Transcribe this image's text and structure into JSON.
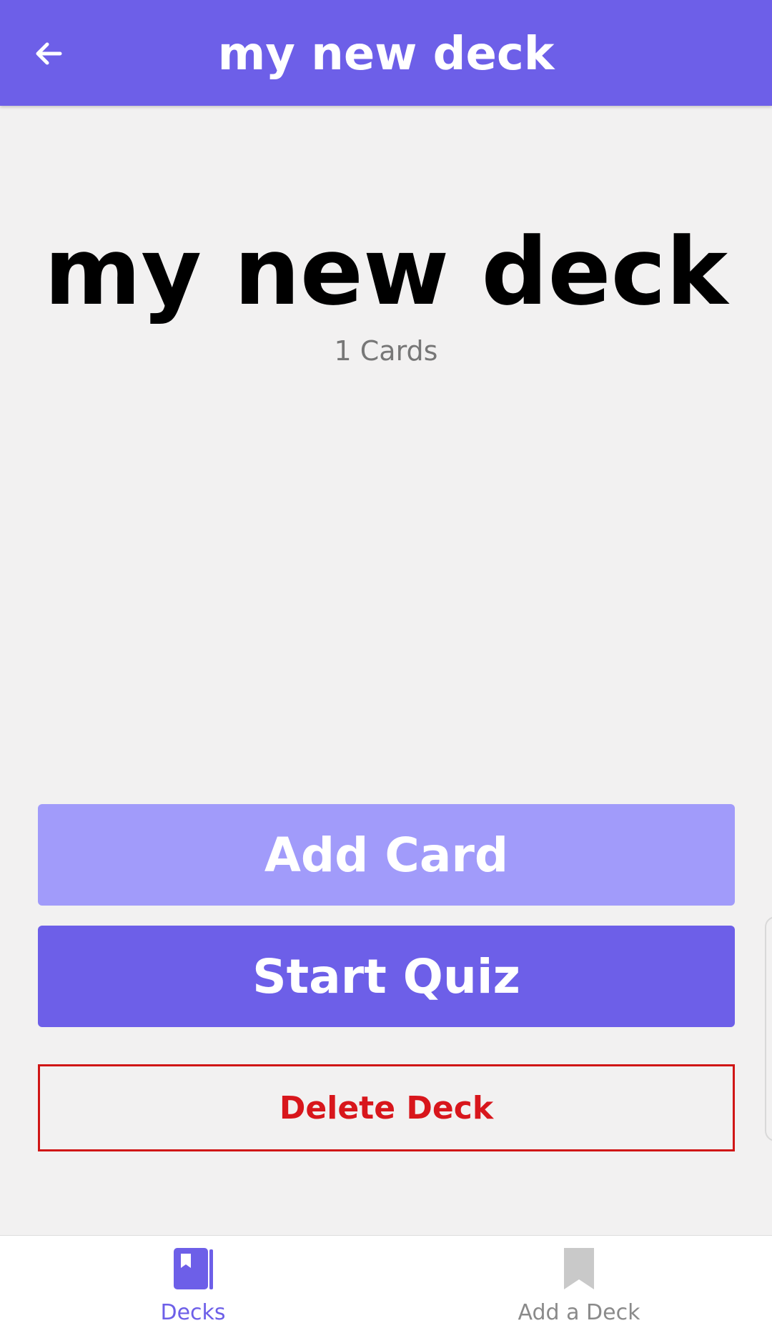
{
  "header": {
    "title": "my new deck",
    "back_icon": "arrow-left-icon"
  },
  "deck": {
    "title": "my new deck",
    "card_count": "1 Cards"
  },
  "actions": {
    "add_card": "Add Card",
    "start_quiz": "Start Quiz",
    "delete_deck": "Delete Deck"
  },
  "tabs": [
    {
      "label": "Decks",
      "icon": "book-icon",
      "active": true
    },
    {
      "label": "Add a Deck",
      "icon": "bookmark-icon",
      "active": false
    }
  ],
  "colors": {
    "primary": "#6d5fe8",
    "primary_light": "#a19bfa",
    "danger": "#d8161c",
    "background": "#f2f1f1",
    "inactive": "#8a8a8a"
  }
}
